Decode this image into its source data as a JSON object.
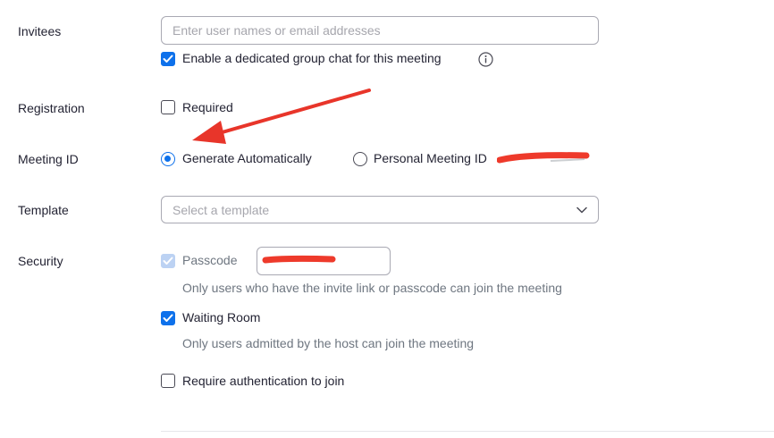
{
  "invitees": {
    "label": "Invitees",
    "placeholder": "Enter user names or email addresses",
    "group_chat_label": "Enable a dedicated group chat for this meeting",
    "group_chat_checked": true
  },
  "registration": {
    "label": "Registration",
    "required_label": "Required",
    "required_checked": false
  },
  "meeting_id": {
    "label": "Meeting ID",
    "options": [
      {
        "label": "Generate Automatically",
        "selected": true
      },
      {
        "label": "Personal Meeting ID",
        "selected": false
      }
    ]
  },
  "template": {
    "label": "Template",
    "placeholder": "Select a template"
  },
  "security": {
    "label": "Security",
    "passcode_label": "Passcode",
    "passcode_checked": true,
    "passcode_hint": "Only users who have the invite link or passcode can join the meeting",
    "waiting_room_label": "Waiting Room",
    "waiting_room_checked": true,
    "waiting_room_hint": "Only users admitted by the host can join the meeting",
    "auth_label": "Require authentication to join",
    "auth_checked": false
  },
  "colors": {
    "accent": "#0e71eb",
    "annotation_red": "#e8352a"
  },
  "icons": {
    "info": "info-icon",
    "chevron": "chevron-down-icon",
    "check": "check-icon"
  }
}
